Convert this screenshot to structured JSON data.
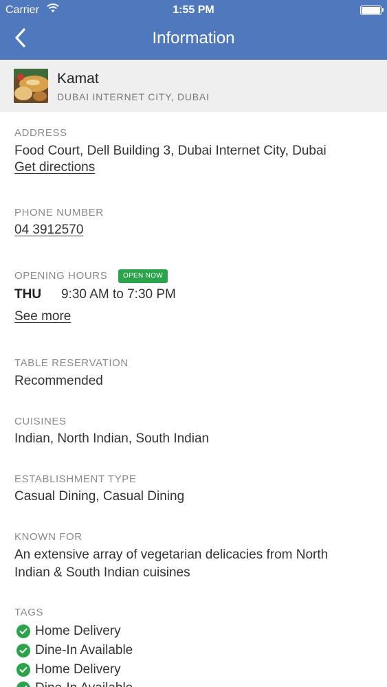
{
  "status_bar": {
    "carrier": "Carrier",
    "time": "1:55 PM"
  },
  "nav": {
    "title": "Information",
    "back_icon": "chevron-left-icon"
  },
  "restaurant": {
    "name": "Kamat",
    "location": "DUBAI INTERNET CITY, DUBAI"
  },
  "address": {
    "label": "ADDRESS",
    "value": "Food Court, Dell Building 3, Dubai Internet City, Dubai",
    "directions_link": "Get directions"
  },
  "phone": {
    "label": "PHONE NUMBER",
    "value": "04 3912570"
  },
  "opening_hours": {
    "label": "OPENING HOURS",
    "badge": "OPEN NOW",
    "day": "THU",
    "hours": "9:30 AM to 7:30 PM",
    "see_more": "See more"
  },
  "table_reservation": {
    "label": "TABLE RESERVATION",
    "value": "Recommended"
  },
  "cuisines": {
    "label": "CUISINES",
    "value": "Indian, North Indian, South Indian"
  },
  "establishment": {
    "label": "ESTABLISHMENT TYPE",
    "value": "Casual Dining, Casual Dining"
  },
  "known_for": {
    "label": "KNOWN FOR",
    "line1": "An extensive array of vegetarian delicacies from North",
    "line2": "Indian & South Indian cuisines"
  },
  "tags": {
    "label": "TAGS",
    "items": [
      "Home Delivery",
      "Dine-In Available",
      "Home Delivery",
      "Dine-In Available"
    ]
  },
  "colors": {
    "nav_bar": "#4f78bd",
    "open_badge": "#2aa34a",
    "check": "#2aa34a"
  }
}
